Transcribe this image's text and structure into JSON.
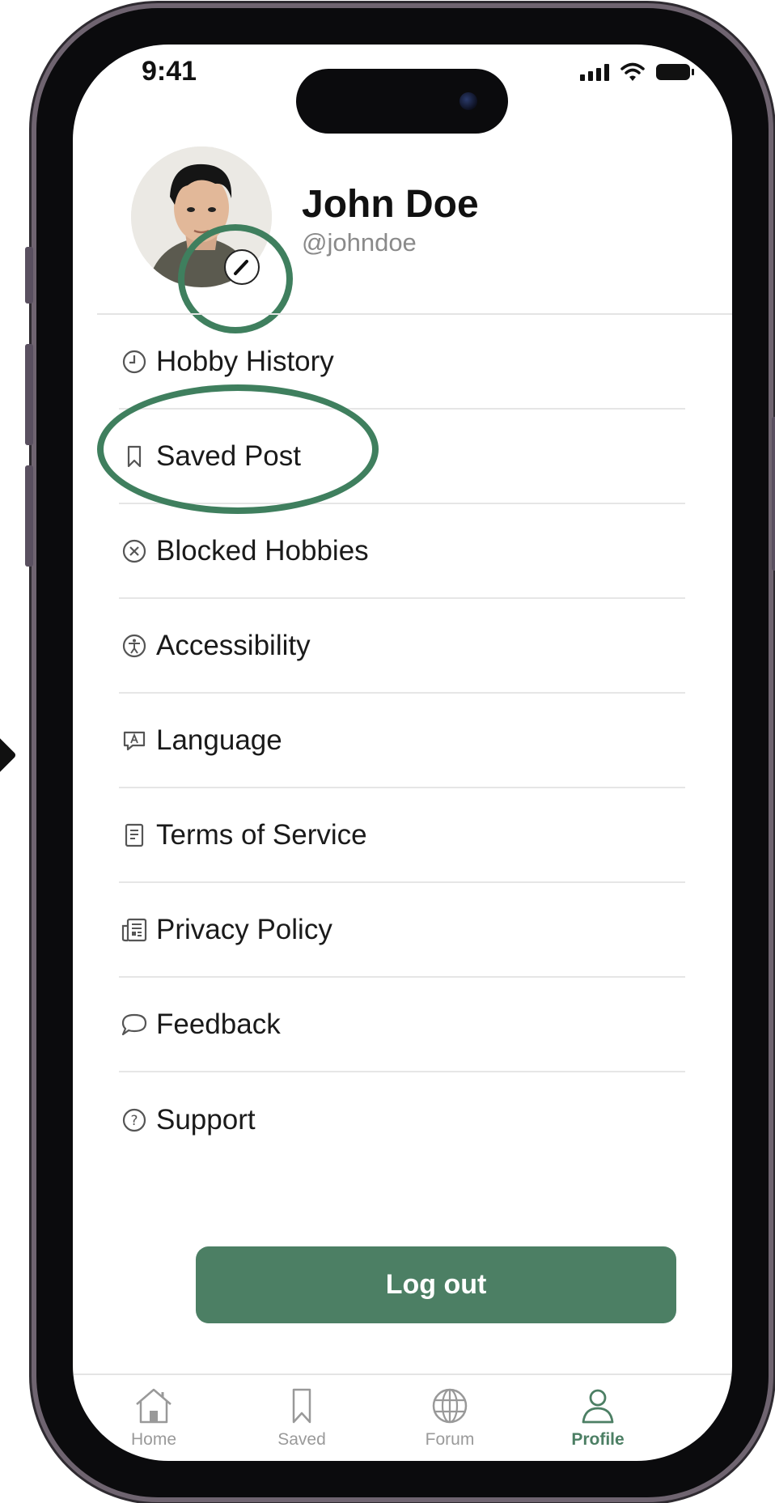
{
  "status_bar": {
    "time": "9:41"
  },
  "profile": {
    "name": "John Doe",
    "handle": "@johndoe"
  },
  "menu": {
    "items": [
      {
        "label": "Hobby History",
        "icon": "clock-icon"
      },
      {
        "label": "Saved Post",
        "icon": "bookmark-icon"
      },
      {
        "label": "Blocked Hobbies",
        "icon": "x-circle-icon"
      },
      {
        "label": "Accessibility",
        "icon": "accessibility-icon"
      },
      {
        "label": "Language",
        "icon": "language-icon"
      },
      {
        "label": "Terms of Service",
        "icon": "document-icon"
      },
      {
        "label": "Privacy Policy",
        "icon": "newspaper-icon"
      },
      {
        "label": "Feedback",
        "icon": "chat-bubble-icon"
      },
      {
        "label": "Support",
        "icon": "help-circle-icon"
      }
    ]
  },
  "logout_label": "Log out",
  "tabbar": {
    "items": [
      {
        "label": "Home",
        "icon": "home-icon"
      },
      {
        "label": "Saved",
        "icon": "bookmark-icon"
      },
      {
        "label": "Forum",
        "icon": "globe-icon"
      },
      {
        "label": "Profile",
        "icon": "user-icon",
        "active": true
      }
    ]
  },
  "colors": {
    "accent": "#4c7f64",
    "annotation": "#3f7f5e"
  }
}
